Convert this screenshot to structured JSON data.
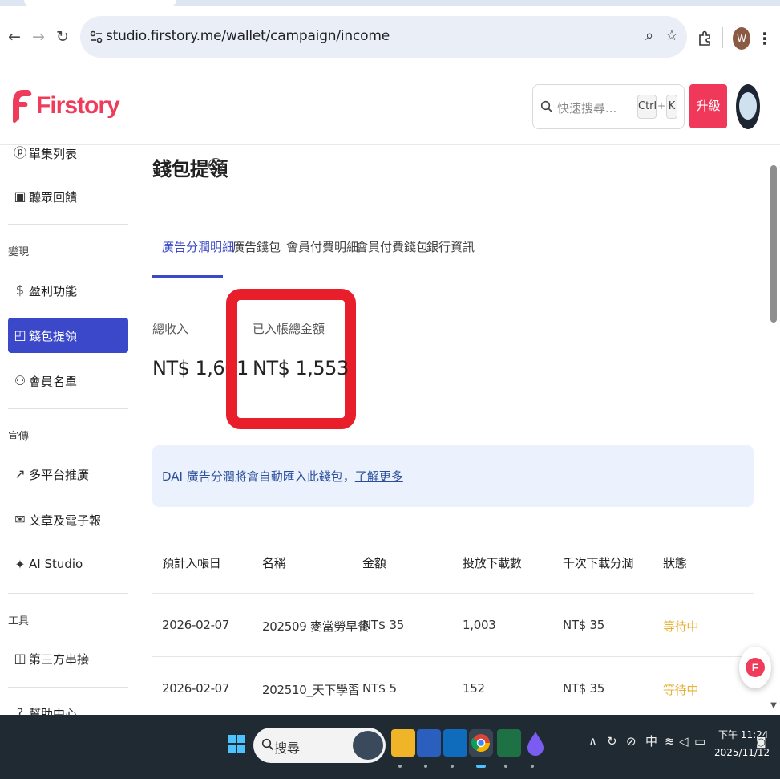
{
  "browser": {
    "url": "studio.firstory.me/wallet/campaign/income",
    "profile_initial": "W"
  },
  "header": {
    "logo_text": "Firstory",
    "search_placeholder": "快速搜尋...",
    "shortcut_key1": "Ctrl",
    "shortcut_plus": "+",
    "shortcut_key2": "K",
    "upgrade_label": "升級"
  },
  "sidebar": {
    "items_top": [
      {
        "label": "單集列表",
        "icon": "podcast-icon"
      },
      {
        "label": "聽眾回饋",
        "icon": "comment-icon"
      }
    ],
    "section_monetize": "變現",
    "items_monetize": [
      {
        "label": "盈利功能",
        "icon": "dollar-icon"
      },
      {
        "label": "錢包提領",
        "icon": "wallet-icon"
      },
      {
        "label": "會員名單",
        "icon": "members-icon"
      }
    ],
    "section_promote": "宣傳",
    "items_promote": [
      {
        "label": "多平台推廣",
        "icon": "trend-icon"
      },
      {
        "label": "文章及電子報",
        "icon": "mail-icon"
      },
      {
        "label": "AI Studio",
        "icon": "sparkle-icon"
      }
    ],
    "section_tools": "工具",
    "items_tools": [
      {
        "label": "第三方串接",
        "icon": "plugin-icon"
      },
      {
        "label": "幫助中心",
        "icon": "help-icon"
      }
    ]
  },
  "main": {
    "title": "錢包提領",
    "tabs": [
      {
        "label": "廣告分潤明細",
        "active": true
      },
      {
        "label": "廣告錢包",
        "active": false
      },
      {
        "label": "會員付費明細",
        "active": false
      },
      {
        "label": "會員付費錢包",
        "active": false
      },
      {
        "label": "銀行資訊",
        "active": false
      }
    ],
    "stats": {
      "total_label": "總收入",
      "total_value": "NT$ 1,661",
      "credited_label": "已入帳總金額",
      "credited_value": "NT$ 1,553"
    },
    "banner": {
      "text": "DAI 廣告分潤將會自動匯入此錢包，",
      "link": "了解更多"
    },
    "table": {
      "columns": [
        "預計入帳日",
        "名稱",
        "金額",
        "投放下載數",
        "千次下載分潤",
        "狀態"
      ],
      "rows": [
        [
          "2026-02-07",
          "202509 麥當勞早餐",
          "NT$ 35",
          "1,003",
          "NT$ 35",
          "等待中"
        ],
        [
          "2026-02-07",
          "202510_天下學習",
          "NT$ 5",
          "152",
          "NT$ 35",
          "等待中"
        ]
      ]
    }
  },
  "taskbar": {
    "search_label": "搜尋",
    "ime": "中",
    "time": "下午 11:24",
    "date": "2025/11/12"
  },
  "colors": {
    "brand": "#f03c5b",
    "accent": "#3b48c9",
    "highlight": "#e81e2a",
    "status_pending": "#e8b23a"
  }
}
